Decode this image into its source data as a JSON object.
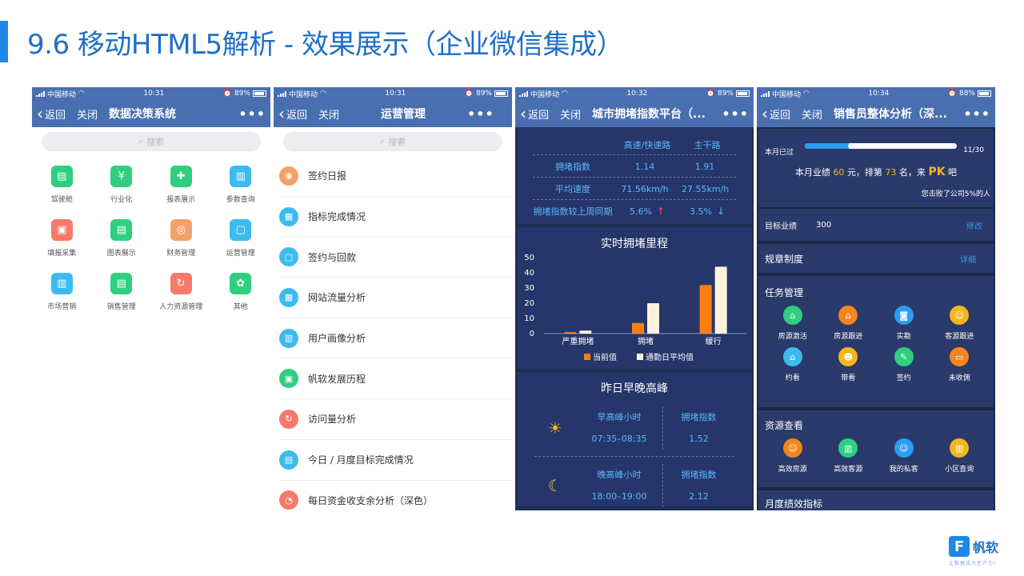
{
  "slide": {
    "title": "9.6 移动HTML5解析 - 效果展示（企业微信集成）",
    "accent_color": "#1e88e5"
  },
  "phone1": {
    "status": {
      "carrier": "中国移动",
      "time": "10:31",
      "battery": "89%"
    },
    "nav": {
      "back": "返回",
      "close": "关闭",
      "title": "数据决策系统",
      "more": "•••"
    },
    "search_placeholder": "搜索",
    "apps": [
      {
        "label": "驾驶舱",
        "icon": "cockpit-icon",
        "color": "#2fcf7f"
      },
      {
        "label": "行业化",
        "icon": "industry-icon",
        "color": "#2fcf7f"
      },
      {
        "label": "报表展示",
        "icon": "report-icon",
        "color": "#2fcf7f"
      },
      {
        "label": "参数查询",
        "icon": "query-icon",
        "color": "#3dbbef"
      },
      {
        "label": "填报采集",
        "icon": "fill-icon",
        "color": "#f7796c"
      },
      {
        "label": "图表展示",
        "icon": "chart-icon",
        "color": "#2fcf7f"
      },
      {
        "label": "财务管理",
        "icon": "finance-icon",
        "color": "#f5a06a"
      },
      {
        "label": "运营管理",
        "icon": "operation-icon",
        "color": "#3dbbef"
      },
      {
        "label": "市场营销",
        "icon": "marketing-icon",
        "color": "#3dbbef"
      },
      {
        "label": "销售管理",
        "icon": "sales-icon",
        "color": "#2fcf7f"
      },
      {
        "label": "人力资源管理",
        "icon": "hr-icon",
        "color": "#f7796c"
      },
      {
        "label": "其他",
        "icon": "other-icon",
        "color": "#2fcf7f"
      }
    ]
  },
  "phone2": {
    "status": {
      "carrier": "中国移动",
      "time": "10:31",
      "battery": "89%"
    },
    "nav": {
      "back": "返回",
      "close": "关闭",
      "title": "运营管理",
      "more": "•••"
    },
    "search_placeholder": "搜索",
    "items": [
      {
        "label": "签约日报",
        "icon": "daily-icon",
        "color": "#f5a06a"
      },
      {
        "label": "指标完成情况",
        "icon": "calendar-icon",
        "color": "#3dbbef"
      },
      {
        "label": "签约与回款",
        "icon": "bag-icon",
        "color": "#3dbbef"
      },
      {
        "label": "网站流量分析",
        "icon": "calendar-icon",
        "color": "#3dbbef"
      },
      {
        "label": "用户画像分析",
        "icon": "bar-icon",
        "color": "#3dbbef"
      },
      {
        "label": "帆软发展历程",
        "icon": "history-icon",
        "color": "#2fcf7f"
      },
      {
        "label": "访问量分析",
        "icon": "refresh-icon",
        "color": "#f7796c"
      },
      {
        "label": "今日 / 月度目标完成情况",
        "icon": "doc-icon",
        "color": "#3dbbef"
      },
      {
        "label": "每日资金收支余分析（深色）",
        "icon": "gauge-icon",
        "color": "#f7796c"
      }
    ]
  },
  "phone3": {
    "status": {
      "carrier": "中国移动",
      "time": "10:32",
      "battery": "89%"
    },
    "nav": {
      "back": "返回",
      "close": "关闭",
      "title": "城市拥堵指数平台（...",
      "more": "•••"
    },
    "kpi": {
      "headers": [
        "高速/快速路",
        "主干路"
      ],
      "rows": [
        {
          "label": "拥堵指数",
          "v1": "1.14",
          "v2": "1.91",
          "a1": "",
          "a2": ""
        },
        {
          "label": "平均速度",
          "v1": "71.56km/h",
          "v2": "27.55km/h",
          "a1": "",
          "a2": ""
        },
        {
          "label": "拥堵指数较上周同期",
          "v1": "5.6%",
          "v2": "3.5%",
          "a1": "↑",
          "a2": "↓"
        }
      ]
    },
    "chart_title": "实时拥堵里程",
    "chart_data": {
      "type": "bar",
      "categories": [
        "严重拥堵",
        "拥堵",
        "缓行"
      ],
      "series": [
        {
          "name": "当前值",
          "values": [
            1,
            7,
            32
          ],
          "color": "#ff7f0e"
        },
        {
          "name": "通勤日平均值",
          "values": [
            2,
            20,
            44
          ],
          "color": "#fdf3dc"
        }
      ],
      "yticks": [
        0,
        10,
        20,
        30,
        40,
        50
      ],
      "ylim": [
        0,
        50
      ],
      "legend": "bottom",
      "grid": false
    },
    "peak": {
      "title": "昨日早晚高峰",
      "rows": [
        {
          "icon": "sun-icon",
          "h1": "早高峰小时",
          "v1": "07:35–08:35",
          "h2": "拥堵指数",
          "v2": "1.52"
        },
        {
          "icon": "moon-icon",
          "h1": "晚高峰小时",
          "v1": "18:00–19:00",
          "h2": "拥堵指数",
          "v2": "2.12"
        }
      ]
    }
  },
  "phone4": {
    "status": {
      "carrier": "中国移动",
      "time": "10:34",
      "battery": "88%"
    },
    "nav": {
      "back": "返回",
      "close": "关闭",
      "title": "销售员整体分析（深...",
      "more": "•••"
    },
    "month": {
      "label": "本月已过",
      "progress": 0.3,
      "count": "11/30"
    },
    "perf": {
      "prefix": "本月业绩",
      "amount": "60",
      "unit": "元，排第",
      "rank": "73",
      "rank_unit": "名，来",
      "pk": "PK",
      "suffix": "吧"
    },
    "beat": "您击败了公司5%的人",
    "target": {
      "label": "目标业绩",
      "value": "300",
      "action": "修改"
    },
    "rules": {
      "label": "规章制度",
      "action": "详细"
    },
    "tasks": {
      "title": "任务管理",
      "items": [
        {
          "label": "房源激活",
          "icon": "house-icon",
          "color": "#2fcf7f"
        },
        {
          "label": "房源跟进",
          "icon": "house-icon",
          "color": "#f5861f"
        },
        {
          "label": "实勘",
          "icon": "camera-icon",
          "color": "#2a9df4"
        },
        {
          "label": "客源跟进",
          "icon": "person-icon",
          "color": "#f5b61f"
        },
        {
          "label": "约看",
          "icon": "house-icon",
          "color": "#3dbbef"
        },
        {
          "label": "带看",
          "icon": "face-icon",
          "color": "#f5b61f"
        },
        {
          "label": "签约",
          "icon": "sign-icon",
          "color": "#2fcf7f"
        },
        {
          "label": "未收佣",
          "icon": "wallet-icon",
          "color": "#f5861f"
        }
      ]
    },
    "resources": {
      "title": "资源查看",
      "items": [
        {
          "label": "高效房源",
          "icon": "person-icon",
          "color": "#f5861f"
        },
        {
          "label": "高效客源",
          "icon": "building-icon",
          "color": "#2fcf7f"
        },
        {
          "label": "我的私客",
          "icon": "person-icon",
          "color": "#2a9df4"
        },
        {
          "label": "小区查询",
          "icon": "building-icon",
          "color": "#f5b61f"
        }
      ]
    },
    "monthly": {
      "title": "月度绩效指标"
    }
  },
  "logo": {
    "text": "帆软",
    "sub": "让数据成为生产力！"
  }
}
